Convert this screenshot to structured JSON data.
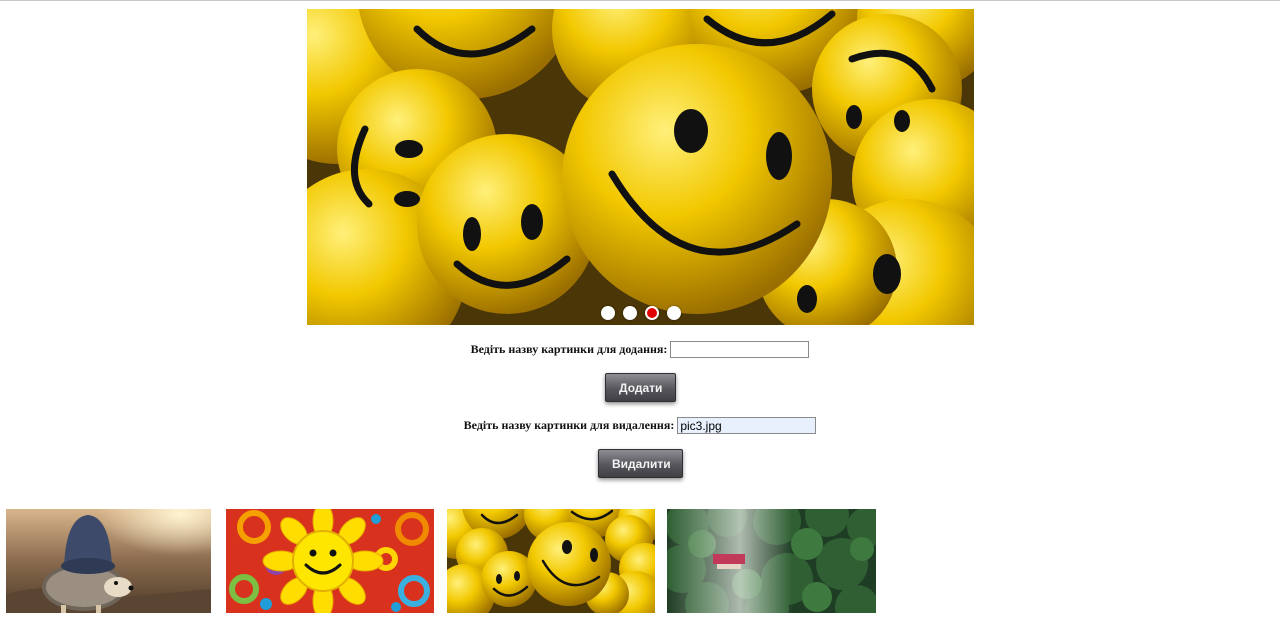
{
  "slider": {
    "current_image": "pic3.jpg",
    "dots": [
      {
        "active": false
      },
      {
        "active": false
      },
      {
        "active": true
      },
      {
        "active": false
      }
    ]
  },
  "add_form": {
    "label": "Ведіть назву картинки для додання:",
    "value": "",
    "button_label": "Додати"
  },
  "delete_form": {
    "label": "Ведіть назву картинки для видалення:",
    "value": "pic3.jpg",
    "button_label": "Видалити"
  },
  "thumbnails": [
    {
      "subject": "hedgehog-in-hat"
    },
    {
      "subject": "smiling-sunflower"
    },
    {
      "subject": "yellow-smiley-balls"
    },
    {
      "subject": "forest-with-red-house"
    }
  ],
  "colors": {
    "active_dot": "#e00000",
    "button": "#56565c"
  }
}
